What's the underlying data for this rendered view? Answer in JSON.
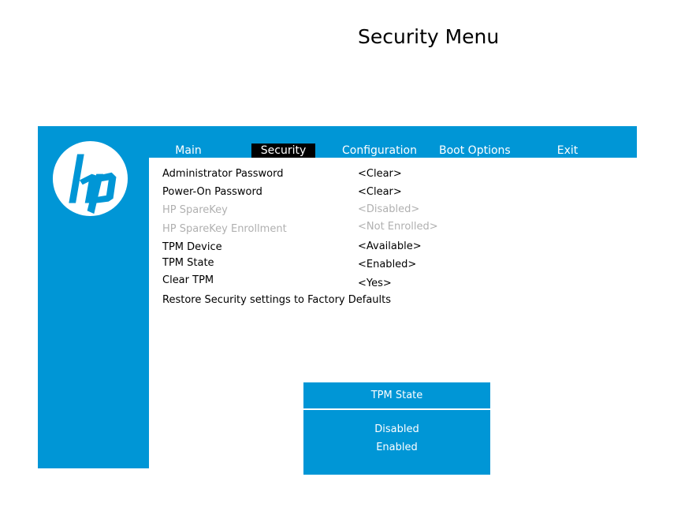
{
  "header": {
    "title": "Security Menu"
  },
  "brand": {
    "logo_icon": "hp-logo-icon",
    "accent_color": "#0096d6"
  },
  "tabs": [
    {
      "label": "Main",
      "active": false
    },
    {
      "label": "Security",
      "active": true
    },
    {
      "label": "Configuration",
      "active": false
    },
    {
      "label": "Boot Options",
      "active": false
    },
    {
      "label": "Exit",
      "active": false
    }
  ],
  "settings": [
    {
      "label": "Administrator Password",
      "value": "<Clear>",
      "enabled": true
    },
    {
      "label": "Power-On Password",
      "value": "<Clear>",
      "enabled": true
    },
    {
      "label": "HP SpareKey",
      "value": "<Disabled>",
      "enabled": false
    },
    {
      "label": "HP SpareKey Enrollment",
      "value": "<Not Enrolled>",
      "enabled": false
    },
    {
      "label": "TPM Device",
      "value": "<Available>",
      "enabled": true
    },
    {
      "label": "TPM State",
      "value": "<Enabled>",
      "enabled": true
    },
    {
      "label": "Clear TPM",
      "value": "<Yes>",
      "enabled": true
    },
    {
      "label": "Restore Security settings to Factory Defaults",
      "value": "",
      "enabled": true
    }
  ],
  "popup": {
    "title": "TPM State",
    "options": [
      "Disabled",
      "Enabled"
    ]
  }
}
